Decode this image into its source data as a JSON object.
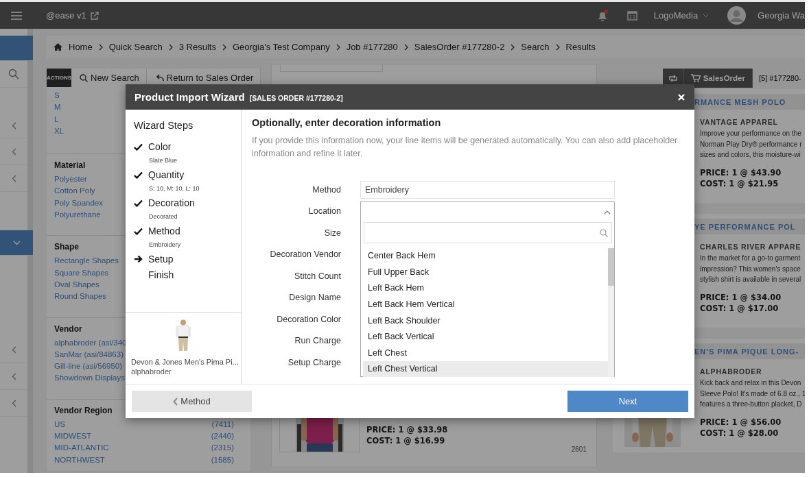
{
  "top_bar": {
    "app_name": "@ease v1",
    "company": "LogoMedia",
    "user": "Georgia Wa"
  },
  "breadcrumb": [
    "Home",
    "Quick Search",
    "3 Results",
    "Georgia's Test Company",
    "Job #177280",
    "SalesOrder #177280-2",
    "Search",
    "Results"
  ],
  "actions_bar": {
    "label": "ACTIONS",
    "buttons": [
      "New Search",
      "Return to Sales Order"
    ]
  },
  "filters": [
    {
      "items": [
        {
          "label": "S"
        },
        {
          "label": "M"
        },
        {
          "label": "L"
        },
        {
          "label": "XL"
        }
      ]
    },
    {
      "heading": "Material",
      "items": [
        {
          "label": "Polyester"
        },
        {
          "label": "Cotton Poly"
        },
        {
          "label": "Poly Spandex"
        },
        {
          "label": "Polyurethane"
        }
      ]
    },
    {
      "heading": "Shape",
      "items": [
        {
          "label": "Rectangle Shapes"
        },
        {
          "label": "Square Shapes"
        },
        {
          "label": "Oval Shapes"
        },
        {
          "label": "Round Shapes"
        }
      ]
    },
    {
      "heading": "Vendor",
      "items": [
        {
          "label": "alphabroder (asi/340"
        },
        {
          "label": "SanMar (asi/84863)"
        },
        {
          "label": "Gill-line (asi/56950)"
        },
        {
          "label": "Showdown Displays"
        }
      ]
    },
    {
      "heading": "Vendor Region",
      "items": [
        {
          "label": "US",
          "count": "(7411)"
        },
        {
          "label": "MIDWEST",
          "count": "(2440)"
        },
        {
          "label": "MID-ATLANTIC",
          "count": "(2315)"
        },
        {
          "label": "NORTHWEST",
          "count": "(1585)"
        }
      ]
    }
  ],
  "middle_result": {
    "price": "PRICE: 1 @ $33.98",
    "cost": "COST: 1 @ $16.99",
    "number": "2601"
  },
  "right_toolbar": {
    "button": "SalesOrder",
    "tab": "[5] #177280-"
  },
  "right_results": [
    {
      "title": "RMANCE MESH POLO",
      "vendor": "VANTAGE APPAREL",
      "description": [
        "Improve your performance on the",
        "Norman Play Dry® performance r",
        "sizes and colors, this moisture-wi"
      ],
      "price": "PRICE: 1 @ $43.90",
      "cost": "COST: 1 @ $21.95"
    },
    {
      "title": "YE PERFORMANCE POL",
      "vendor": "CHARLES RIVER APPARE",
      "description": [
        "In the market for a go-to garment",
        "impression? This women's space",
        "stylish shirt is available in several"
      ],
      "price": "PRICE: 1 @ $34.00",
      "cost": "COST: 1 @ $17.00"
    },
    {
      "title": "EN'S PIMA PIQUE LONG-",
      "vendor": "ALPHABRODER",
      "description": [
        "Kick back and relax in this Devon",
        "Sleeve Polo! It's made of 6.8 oz., 1",
        "features a three-button placket, D"
      ],
      "price": "PRICE: 1 @ $56.00",
      "cost": "COST: 1 @ $28.00",
      "picture": true
    }
  ],
  "modal": {
    "title": "Product Import Wizard",
    "subtitle": "[SALES ORDER #177280-2]",
    "steps_heading": "Wizard Steps",
    "steps": [
      {
        "label": "Color",
        "detail": "Slate Blue",
        "checked": true,
        "current": false
      },
      {
        "label": "Quantity",
        "detail": "S: 10, M: 10, L: 10",
        "checked": true,
        "current": false
      },
      {
        "label": "Decoration",
        "detail": "Decorated",
        "checked": true,
        "current": false
      },
      {
        "label": "Method",
        "detail": "Embroidery",
        "checked": true,
        "current": false
      },
      {
        "label": "Setup",
        "checked": false,
        "current": true
      },
      {
        "label": "Finish",
        "checked": false,
        "current": false
      }
    ],
    "product": {
      "name": "Devon & Jones Men's Pima Pi...",
      "vendor": "alphabroder"
    },
    "heading": "Optionally, enter decoration information",
    "description": "If you provide this information now, your line items will be generated automatically. You can also add placeholder information and refine it later.",
    "fields": [
      {
        "label": "Method",
        "kind": "text",
        "value": "Embroidery"
      },
      {
        "label": "Location",
        "kind": "select",
        "open": true,
        "options": [
          {
            "label": "Center Back Hem",
            "selected": false
          },
          {
            "label": "Full Upper Back",
            "selected": false
          },
          {
            "label": "Left Back Hem",
            "selected": false
          },
          {
            "label": "Left Back Hem Vertical",
            "selected": false
          },
          {
            "label": "Left Back Shoulder",
            "selected": false
          },
          {
            "label": "Left Back Vertical",
            "selected": false
          },
          {
            "label": "Left Chest",
            "selected": false
          },
          {
            "label": "Left Chest Vertical",
            "selected": true
          }
        ]
      },
      {
        "label": "Size"
      },
      {
        "label": "Decoration Vendor"
      },
      {
        "label": "Stitch Count"
      },
      {
        "label": "Design Name"
      },
      {
        "label": "Decoration Color"
      },
      {
        "label": "Run Charge"
      },
      {
        "label": "Setup Charge"
      }
    ],
    "back_button": "Method",
    "next_button": "Next"
  }
}
